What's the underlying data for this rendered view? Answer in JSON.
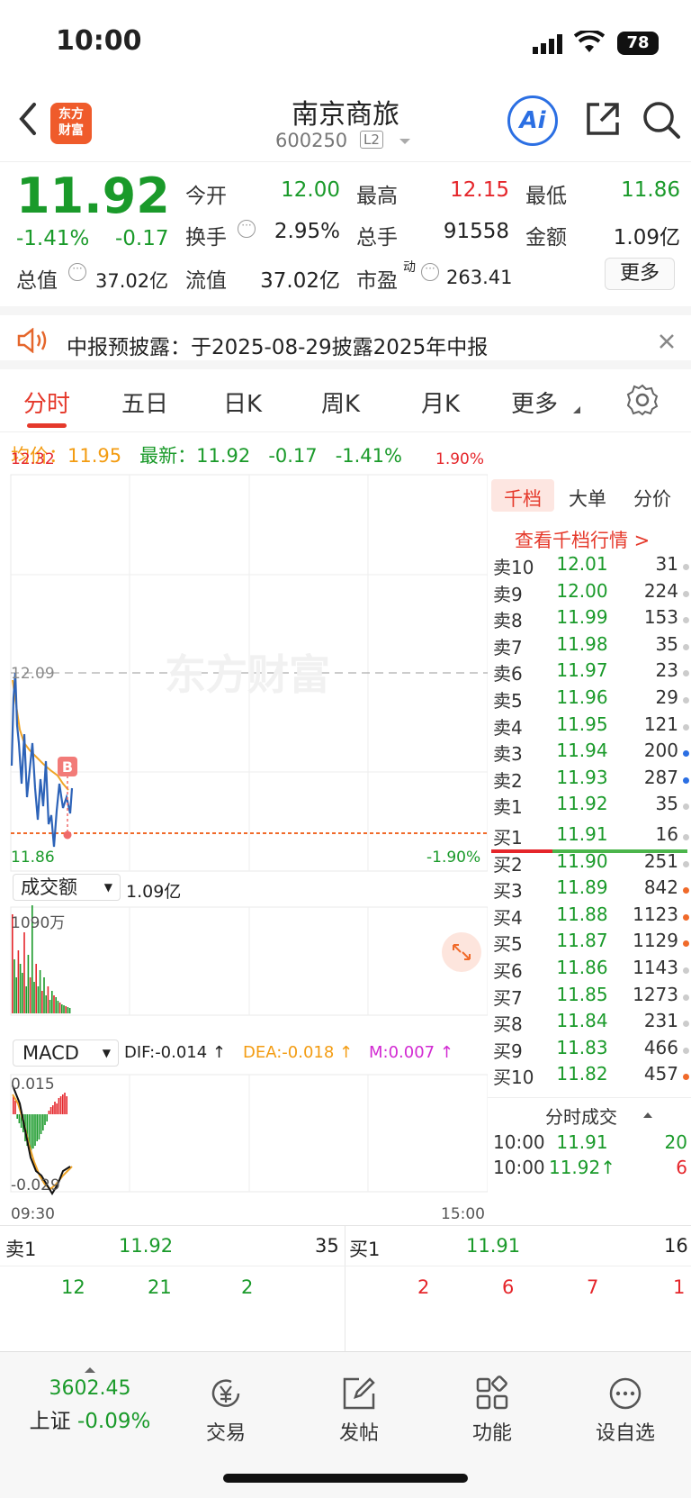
{
  "status": {
    "time": "10:00",
    "battery": "78"
  },
  "nav": {
    "name": "南京商旅",
    "code": "600250",
    "badge": "L2",
    "logo_l1": "东方",
    "logo_l2": "财富",
    "ai": "Ai"
  },
  "quote": {
    "price": "11.92",
    "pct": "-1.41%",
    "chg": "-0.17",
    "open_label": "今开",
    "open": "12.00",
    "high_label": "最高",
    "high": "12.15",
    "low_label": "最低",
    "low": "11.86",
    "turnover_label": "换手",
    "turnover": "2.95%",
    "vol_label": "总手",
    "vol": "91558",
    "amount_label": "金额",
    "amount": "1.09亿",
    "mktcap_label": "总值",
    "mktcap": "37.02亿",
    "float_label": "流值",
    "float": "37.02亿",
    "pe_label": "市盈",
    "pe_sup": "动",
    "pe": "263.41",
    "more": "更多"
  },
  "notice": {
    "text": "中报预披露：于2025-08-29披露2025年中报"
  },
  "tabs": [
    "分时",
    "五日",
    "日K",
    "周K",
    "月K",
    "更多"
  ],
  "avg": {
    "avg_label": "均价：",
    "avg": "11.95",
    "last_label": "最新：",
    "last": "11.92",
    "chg": "-0.17",
    "pct": "-1.41%"
  },
  "chart": {
    "price_top": "12.32",
    "pct_top": "1.90%",
    "prev_close": "12.09",
    "price_bottom": "11.86",
    "pct_bottom": "-1.90%",
    "vol_selector": "成交额",
    "vol_total": "1.09亿",
    "vol_max": "1090万",
    "macd_selector": "MACD",
    "dif": "DIF:-0.014 ↑",
    "dea": "DEA:-0.018 ↑",
    "m": "M:0.007 ↑",
    "macd_top": "0.015",
    "macd_bottom": "-0.029",
    "t_start": "09:30",
    "t_end": "15:00",
    "watermark": "东方财富",
    "marker": "B"
  },
  "book": {
    "tabs": [
      "千档",
      "大单",
      "分价"
    ],
    "link": "查看千档行情 >",
    "sells": [
      {
        "label": "卖10",
        "price": "12.01",
        "vol": "31"
      },
      {
        "label": "卖9",
        "price": "12.00",
        "vol": "224"
      },
      {
        "label": "卖8",
        "price": "11.99",
        "vol": "153"
      },
      {
        "label": "卖7",
        "price": "11.98",
        "vol": "35"
      },
      {
        "label": "卖6",
        "price": "11.97",
        "vol": "23"
      },
      {
        "label": "卖5",
        "price": "11.96",
        "vol": "29"
      },
      {
        "label": "卖4",
        "price": "11.95",
        "vol": "121"
      },
      {
        "label": "卖3",
        "price": "11.94",
        "vol": "200"
      },
      {
        "label": "卖2",
        "price": "11.93",
        "vol": "287"
      },
      {
        "label": "卖1",
        "price": "11.92",
        "vol": "35"
      }
    ],
    "buys": [
      {
        "label": "买1",
        "price": "11.91",
        "vol": "16"
      },
      {
        "label": "买2",
        "price": "11.90",
        "vol": "251"
      },
      {
        "label": "买3",
        "price": "11.89",
        "vol": "842"
      },
      {
        "label": "买4",
        "price": "11.88",
        "vol": "1123"
      },
      {
        "label": "买5",
        "price": "11.87",
        "vol": "1129"
      },
      {
        "label": "买6",
        "price": "11.86",
        "vol": "1143"
      },
      {
        "label": "买7",
        "price": "11.85",
        "vol": "1273"
      },
      {
        "label": "买8",
        "price": "11.84",
        "vol": "231"
      },
      {
        "label": "买9",
        "price": "11.83",
        "vol": "466"
      },
      {
        "label": "买10",
        "price": "11.82",
        "vol": "457"
      }
    ],
    "ticks_title": "分时成交",
    "ticks": [
      {
        "time": "10:00",
        "price": "11.91",
        "vol": "20"
      },
      {
        "time": "10:00",
        "price": "11.92↑",
        "vol": "6"
      }
    ]
  },
  "bidask": {
    "sell_label": "卖1",
    "sell_price": "11.92",
    "sell_vol": "35",
    "buy_label": "买1",
    "buy_price": "11.91",
    "buy_vol": "16",
    "sell_detail": [
      "12",
      "21",
      "2"
    ],
    "buy_detail": [
      "2",
      "6",
      "7",
      "1"
    ]
  },
  "toolbar": {
    "index_value": "3602.45",
    "index_name": "上证",
    "index_pct": "-0.09%",
    "trade": "交易",
    "post": "发帖",
    "func": "功能",
    "watch": "设自选"
  }
}
